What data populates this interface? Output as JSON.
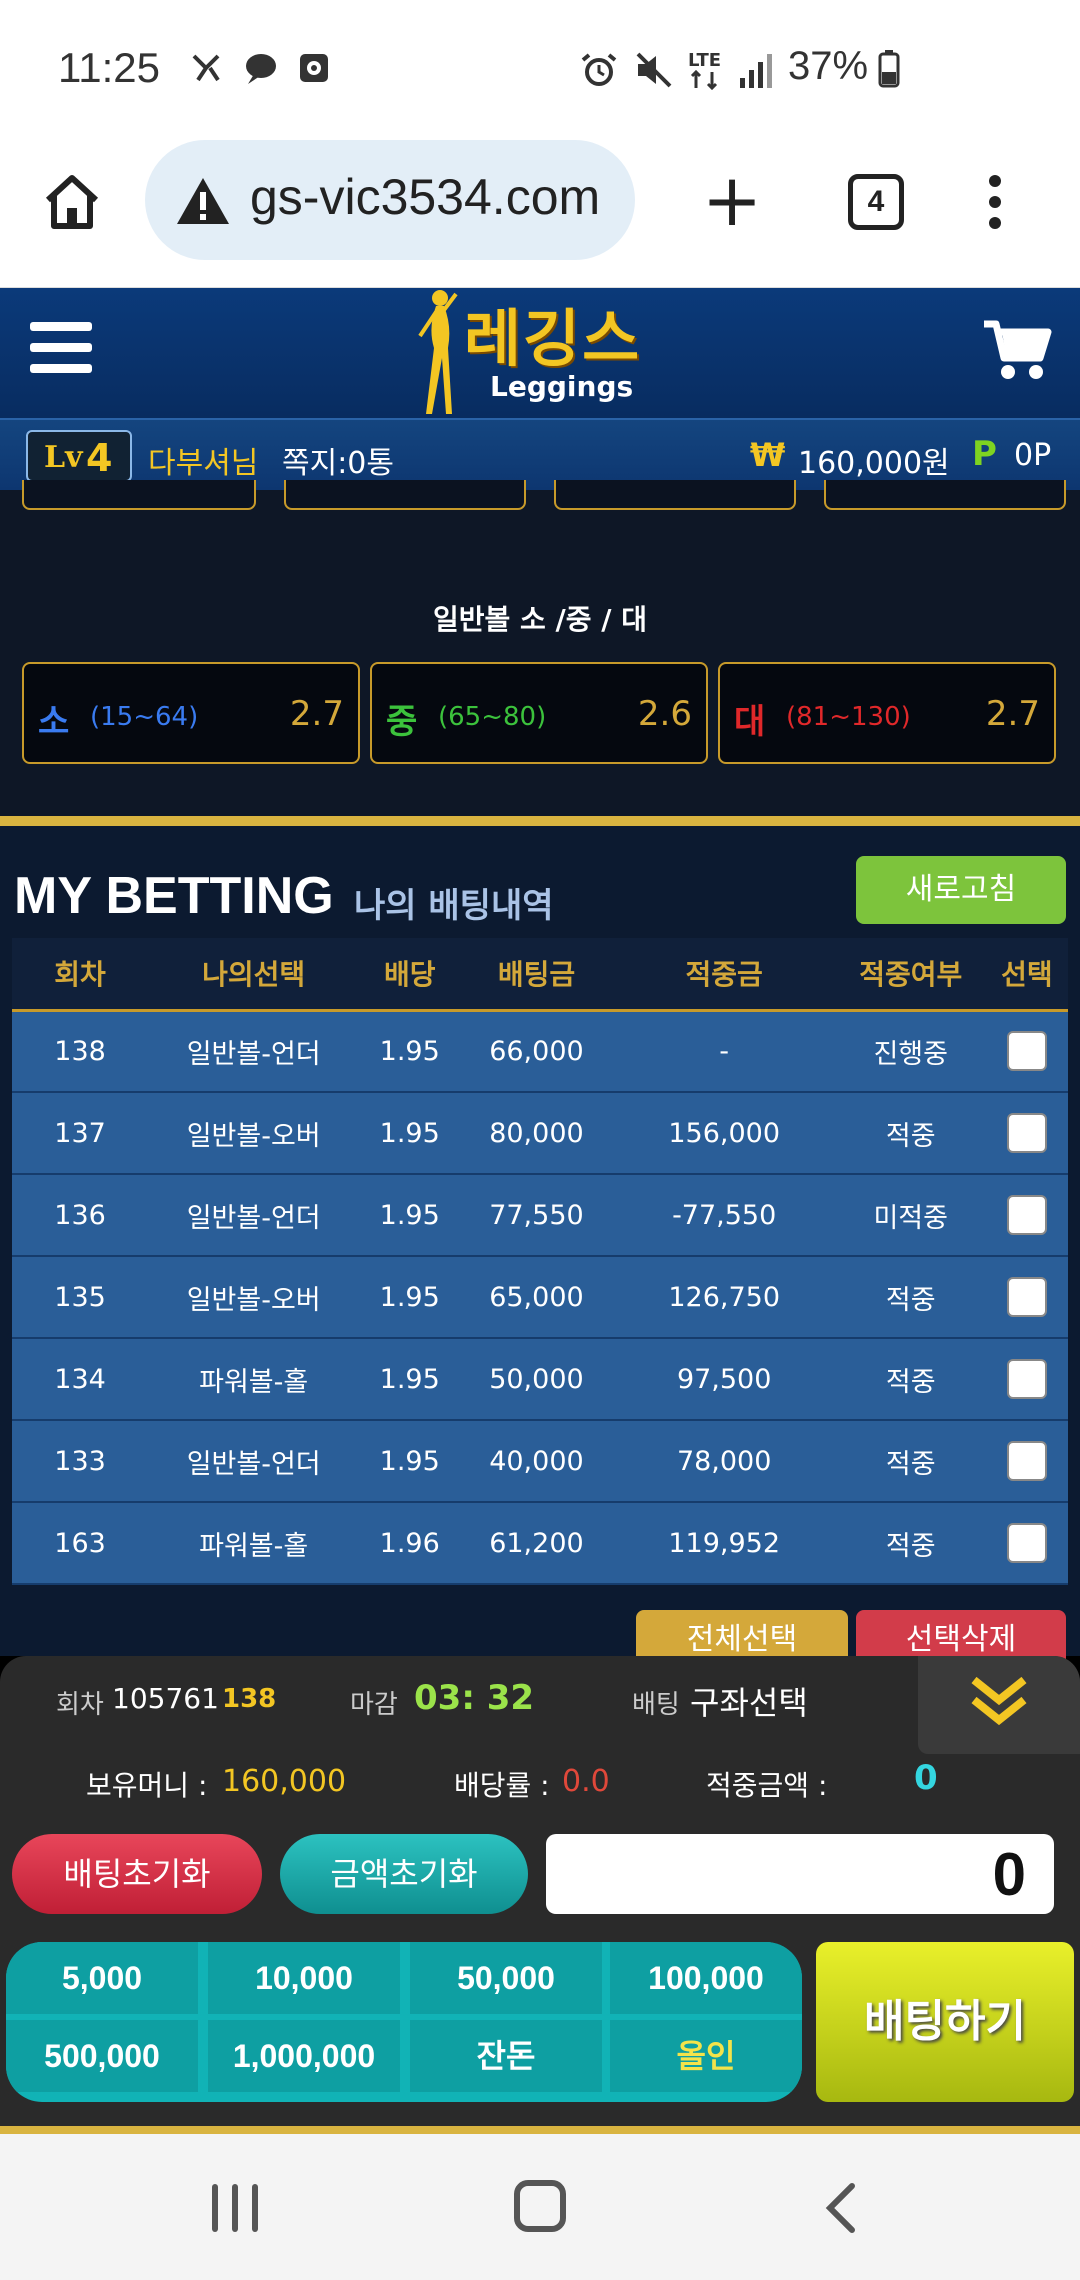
{
  "status_bar": {
    "time": "11:25",
    "battery": "37%",
    "icons": [
      "vpn-key-icon",
      "chat-bubble-icon",
      "screen-record-icon",
      "alarm-icon",
      "mute-icon",
      "lte-icon",
      "signal-icon",
      "battery-icon"
    ]
  },
  "browser": {
    "url": "gs-vic3534.com",
    "tab_count": "4"
  },
  "site": {
    "logo_ko": "레깅스",
    "logo_en": "Leggings"
  },
  "user": {
    "level_prefix": "Lv",
    "level": "4",
    "name": "다부셔님",
    "messages": "쪽지:0통",
    "currency_icon": "₩",
    "money": "160,000원",
    "point_icon": "P",
    "points": "0P"
  },
  "game": {
    "section_title": "일반볼 소 /중 / 대",
    "options": [
      {
        "name": "소",
        "range": "(15~64)",
        "odds": "2.7",
        "color": "#3a7bf0"
      },
      {
        "name": "중",
        "range": "(65~80)",
        "odds": "2.6",
        "color": "#3cc23c"
      },
      {
        "name": "대",
        "range": "(81~130)",
        "odds": "2.7",
        "color": "#e0282a"
      }
    ]
  },
  "my_betting": {
    "title": "MY BETTING",
    "subtitle": "나의 배팅내역",
    "refresh_label": "새로고침",
    "columns": [
      "회차",
      "나의선택",
      "배당",
      "배팅금",
      "적중금",
      "적중여부",
      "선택"
    ],
    "rows": [
      {
        "round": "138",
        "choice": "일반볼-언더",
        "odds": "1.95",
        "bet": "66,000",
        "payout": "-",
        "result": "진행중",
        "status": "prog"
      },
      {
        "round": "137",
        "choice": "일반볼-오버",
        "odds": "1.95",
        "bet": "80,000",
        "payout": "156,000",
        "result": "적중",
        "status": "win"
      },
      {
        "round": "136",
        "choice": "일반볼-언더",
        "odds": "1.95",
        "bet": "77,550",
        "payout": "-77,550",
        "result": "미적중",
        "status": "lose"
      },
      {
        "round": "135",
        "choice": "일반볼-오버",
        "odds": "1.95",
        "bet": "65,000",
        "payout": "126,750",
        "result": "적중",
        "status": "win"
      },
      {
        "round": "134",
        "choice": "파워볼-홀",
        "odds": "1.95",
        "bet": "50,000",
        "payout": "97,500",
        "result": "적중",
        "status": "win"
      },
      {
        "round": "133",
        "choice": "일반볼-언더",
        "odds": "1.95",
        "bet": "40,000",
        "payout": "78,000",
        "result": "적중",
        "status": "win"
      },
      {
        "round": "163",
        "choice": "파워볼-홀",
        "odds": "1.96",
        "bet": "61,200",
        "payout": "119,952",
        "result": "적중",
        "status": "win"
      }
    ],
    "select_all_label": "전체선택",
    "delete_selected_label": "선택삭제"
  },
  "bet_slip": {
    "round_label": "회차",
    "round_value": "105761",
    "round_number": "138",
    "close_label": "마감",
    "close_time": "03: 32",
    "bet_label": "배팅",
    "bet_value": "구좌선택",
    "money_label": "보유머니 :",
    "money_value": "160,000",
    "rate_label": "배당률 :",
    "rate_value": "0.0",
    "win_label": "적중금액 :",
    "win_value": "0",
    "reset_bet_label": "배팅초기화",
    "reset_amount_label": "금액초기화",
    "amount_value": "0",
    "chips": [
      "5,000",
      "10,000",
      "50,000",
      "100,000",
      "500,000",
      "1,000,000",
      "잔돈",
      "올인"
    ],
    "bet_button_label": "배팅하기"
  }
}
